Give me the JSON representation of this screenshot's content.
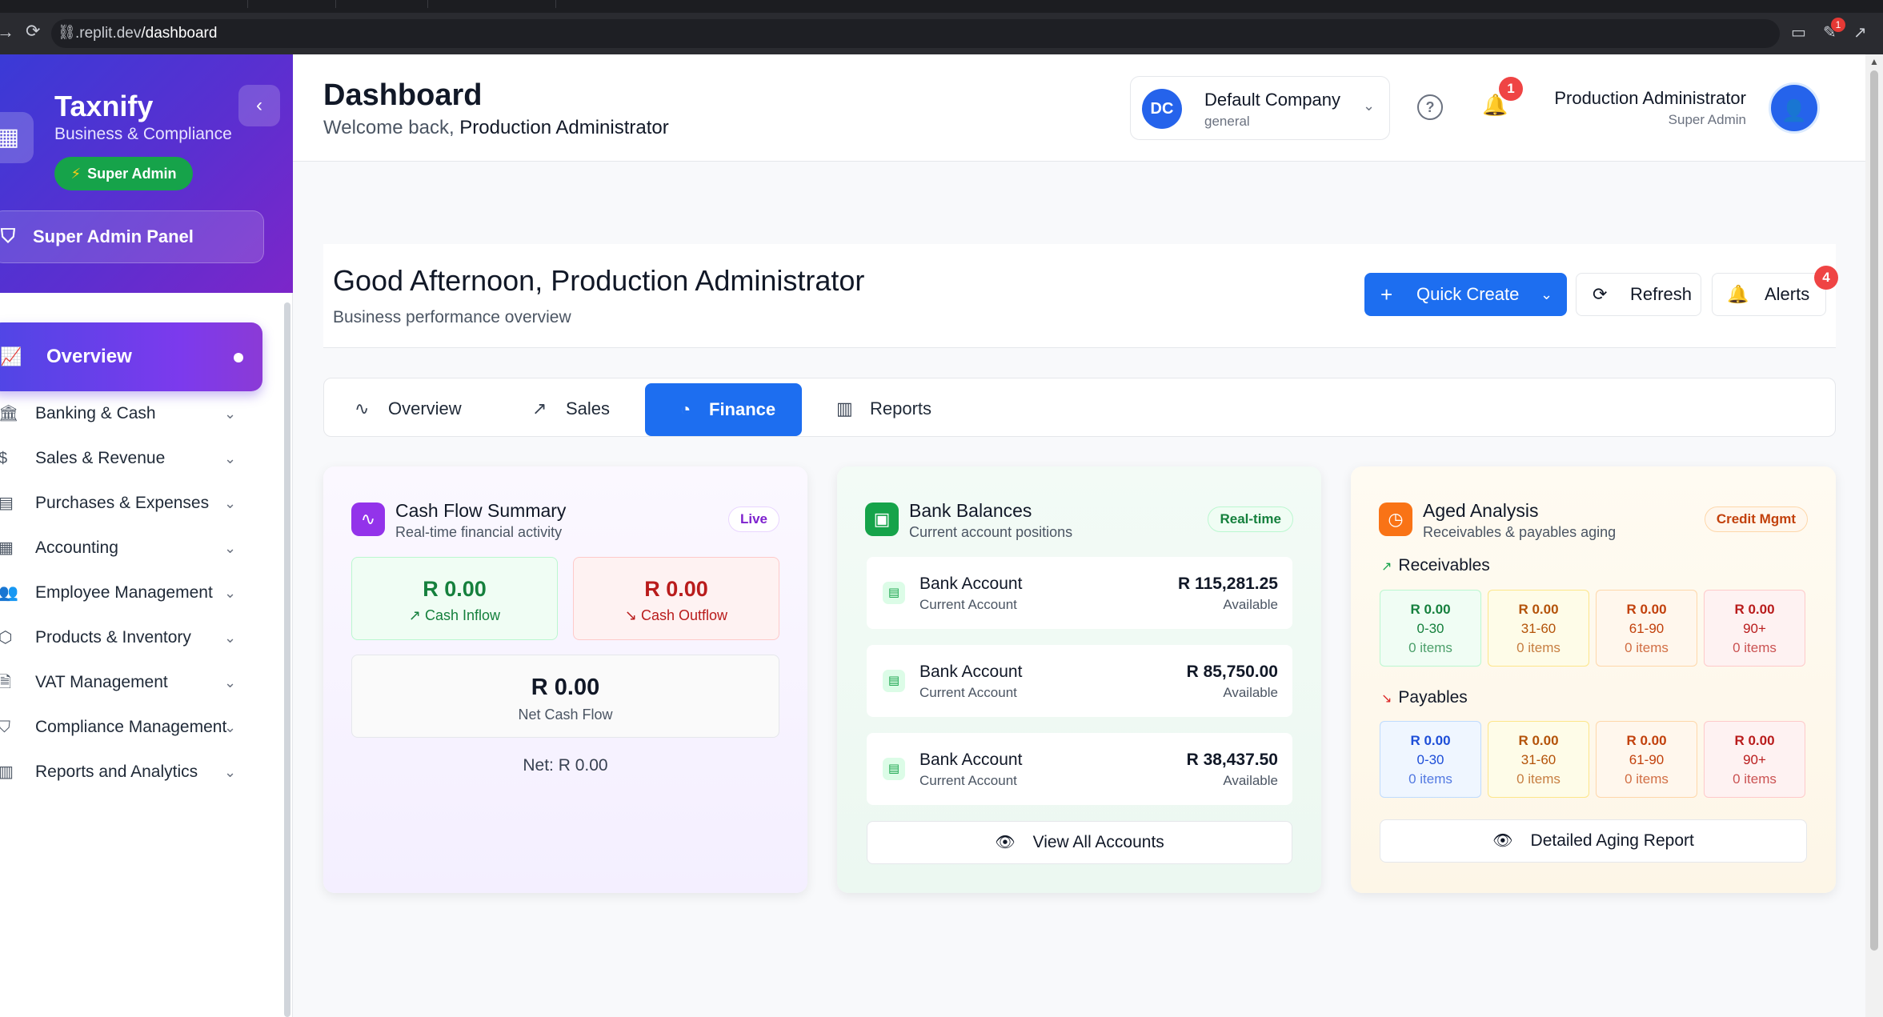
{
  "browser": {
    "url_prefix": ".replit.dev",
    "url_path": "/dashboard",
    "extension_badge": "1"
  },
  "sidebar": {
    "brand": "Taxnify",
    "subtitle": "Business & Compliance",
    "role_badge": "Super Admin",
    "panel_label": "Super Admin Panel",
    "active_item": "Overview",
    "items": [
      {
        "label": "Banking & Cash",
        "icon": "bank-icon"
      },
      {
        "label": "Sales & Revenue",
        "icon": "dollar-icon"
      },
      {
        "label": "Purchases & Expenses",
        "icon": "receipt-icon"
      },
      {
        "label": "Accounting",
        "icon": "calculator-icon"
      },
      {
        "label": "Employee Management",
        "icon": "users-icon"
      },
      {
        "label": "Products & Inventory",
        "icon": "box-icon"
      },
      {
        "label": "VAT Management",
        "icon": "document-icon"
      },
      {
        "label": "Compliance Management",
        "icon": "shield-icon"
      },
      {
        "label": "Reports and Analytics",
        "icon": "bar-chart-icon"
      }
    ]
  },
  "header": {
    "title": "Dashboard",
    "welcome_prefix": "Welcome back, ",
    "welcome_name": "Production Administrator",
    "company_initials": "DC",
    "company_name": "Default Company",
    "company_sub": "general",
    "notification_count": "1",
    "user_name": "Production Administrator",
    "user_role": "Super Admin"
  },
  "greeting": {
    "title": "Good Afternoon, Production Administrator",
    "subtitle": "Business performance overview",
    "quick_create": "Quick Create",
    "refresh": "Refresh",
    "alerts": "Alerts",
    "alerts_count": "4"
  },
  "tabs": [
    {
      "label": "Overview"
    },
    {
      "label": "Sales"
    },
    {
      "label": "Finance"
    },
    {
      "label": "Reports"
    }
  ],
  "active_tab": "Finance",
  "cash_flow": {
    "title": "Cash Flow Summary",
    "subtitle": "Real-time financial activity",
    "pill": "Live",
    "inflow_value": "R 0.00",
    "inflow_label": "Cash Inflow",
    "outflow_value": "R 0.00",
    "outflow_label": "Cash Outflow",
    "net_value": "R 0.00",
    "net_label": "Net Cash Flow",
    "net_line": "Net: R 0.00"
  },
  "bank_balances": {
    "title": "Bank Balances",
    "subtitle": "Current account positions",
    "pill": "Real-time",
    "accounts": [
      {
        "name": "Bank Account",
        "type": "Current Account",
        "amount": "R 115,281.25",
        "status": "Available"
      },
      {
        "name": "Bank Account",
        "type": "Current Account",
        "amount": "R 85,750.00",
        "status": "Available"
      },
      {
        "name": "Bank Account",
        "type": "Current Account",
        "amount": "R 38,437.50",
        "status": "Available"
      }
    ],
    "view_all": "View All Accounts"
  },
  "aged_analysis": {
    "title": "Aged Analysis",
    "subtitle": "Receivables & payables aging",
    "pill": "Credit Mgmt",
    "receivables_label": "Receivables",
    "payables_label": "Payables",
    "receivables": [
      {
        "value": "R 0.00",
        "range": "0-30",
        "count": "0 items"
      },
      {
        "value": "R 0.00",
        "range": "31-60",
        "count": "0 items"
      },
      {
        "value": "R 0.00",
        "range": "61-90",
        "count": "0 items"
      },
      {
        "value": "R 0.00",
        "range": "90+",
        "count": "0 items"
      }
    ],
    "payables": [
      {
        "value": "R 0.00",
        "range": "0-30",
        "count": "0 items"
      },
      {
        "value": "R 0.00",
        "range": "31-60",
        "count": "0 items"
      },
      {
        "value": "R 0.00",
        "range": "61-90",
        "count": "0 items"
      },
      {
        "value": "R 0.00",
        "range": "90+",
        "count": "0 items"
      }
    ],
    "report_button": "Detailed Aging Report"
  },
  "colors": {
    "primary": "#1d6ef0",
    "sidebar_gradient_start": "#3a3ad6",
    "sidebar_gradient_end": "#7c26c9",
    "success": "#16a34a",
    "danger": "#ef4444",
    "purple": "#7c3aed",
    "orange": "#f97316"
  }
}
